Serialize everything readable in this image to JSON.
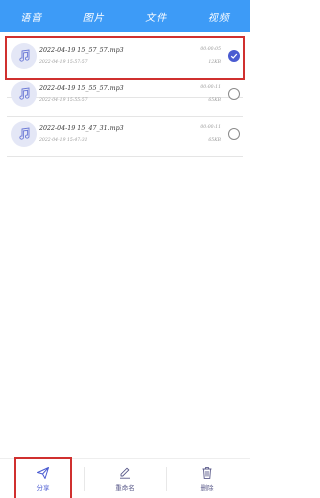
{
  "tabs": [
    "语音",
    "图片",
    "文件",
    "视频"
  ],
  "files": [
    {
      "name": "2022-04-19 15_57_57.mp3",
      "date": "2022-04-19 15:57:57",
      "duration": "00:00:05",
      "size": "12KB",
      "selected": true
    },
    {
      "name": "2022-04-19 15_55_57.mp3",
      "date": "2022-04-19 15:55:57",
      "duration": "00:00:11",
      "size": "65KB",
      "selected": false
    },
    {
      "name": "2022-04-19 15_47_31.mp3",
      "date": "2022-04-19 15:47:31",
      "duration": "00:00:11",
      "size": "65KB",
      "selected": false
    }
  ],
  "actions": {
    "share": "分享",
    "rename": "重命名",
    "delete": "删除"
  },
  "colors": {
    "tabbar": "#3d9bf7",
    "accent": "#4a5bd1",
    "highlight": "#d0302f"
  }
}
